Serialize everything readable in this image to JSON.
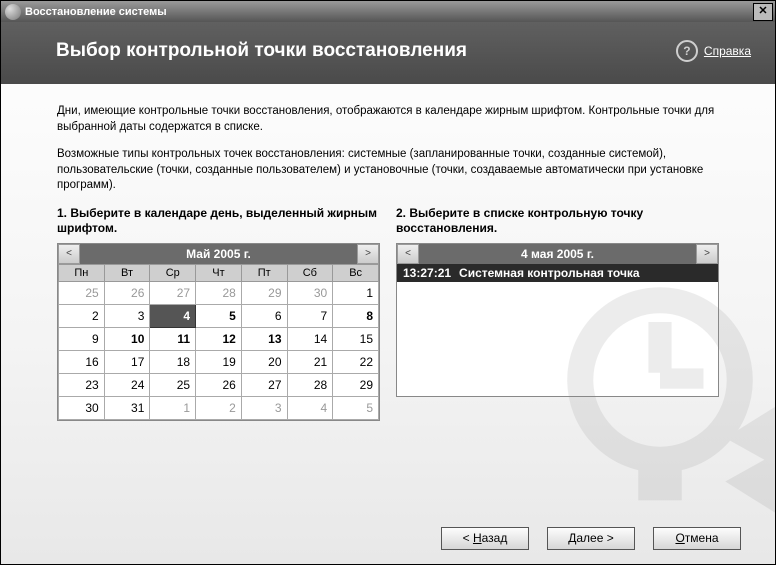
{
  "window": {
    "title": "Восстановление системы",
    "close_glyph": "✕"
  },
  "header": {
    "title": "Выбор контрольной точки восстановления",
    "help_link": "Справка",
    "help_glyph": "?"
  },
  "intro": {
    "p1": "Дни, имеющие контрольные точки восстановления, отображаются в календаре жирным шрифтом. Контрольные точки для выбранной даты содержатся в списке.",
    "p2": "Возможные типы контрольных точек восстановления: системные (запланированные точки, созданные системой), пользовательские (точки, созданные пользователем) и установочные (точки, создаваемые автоматически при установке программ)."
  },
  "steps": {
    "step1_label": "1. Выберите в календаре день, выделенный жирным шрифтом.",
    "step2_label": "2. Выберите в списке контрольную точку восстановления."
  },
  "calendar": {
    "prev_glyph": "<",
    "next_glyph": ">",
    "month_label": "Май 2005 г.",
    "weekdays": [
      "Пн",
      "Вт",
      "Ср",
      "Чт",
      "Пт",
      "Сб",
      "Вс"
    ],
    "weeks": [
      [
        {
          "d": 25,
          "other": true
        },
        {
          "d": 26,
          "other": true
        },
        {
          "d": 27,
          "other": true
        },
        {
          "d": 28,
          "other": true
        },
        {
          "d": 29,
          "other": true
        },
        {
          "d": 30,
          "other": true
        },
        {
          "d": 1
        }
      ],
      [
        {
          "d": 2
        },
        {
          "d": 3
        },
        {
          "d": 4,
          "bold": true,
          "selected": true
        },
        {
          "d": 5,
          "bold": true
        },
        {
          "d": 6
        },
        {
          "d": 7
        },
        {
          "d": 8,
          "bold": true
        }
      ],
      [
        {
          "d": 9
        },
        {
          "d": 10,
          "bold": true
        },
        {
          "d": 11,
          "bold": true
        },
        {
          "d": 12,
          "bold": true
        },
        {
          "d": 13,
          "bold": true
        },
        {
          "d": 14
        },
        {
          "d": 15
        }
      ],
      [
        {
          "d": 16
        },
        {
          "d": 17
        },
        {
          "d": 18
        },
        {
          "d": 19
        },
        {
          "d": 20
        },
        {
          "d": 21
        },
        {
          "d": 22
        }
      ],
      [
        {
          "d": 23
        },
        {
          "d": 24
        },
        {
          "d": 25
        },
        {
          "d": 26
        },
        {
          "d": 27
        },
        {
          "d": 28
        },
        {
          "d": 29
        }
      ],
      [
        {
          "d": 30
        },
        {
          "d": 31
        },
        {
          "d": 1,
          "other": true
        },
        {
          "d": 2,
          "other": true
        },
        {
          "d": 3,
          "other": true
        },
        {
          "d": 4,
          "other": true
        },
        {
          "d": 5,
          "other": true
        }
      ]
    ]
  },
  "restore_points": {
    "date_label": "4 мая 2005 г.",
    "prev_glyph": "<",
    "next_glyph": ">",
    "items": [
      {
        "time": "13:27:21",
        "desc": "Системная контрольная точка",
        "selected": true
      }
    ]
  },
  "buttons": {
    "back": "< Назад",
    "back_u": "Н",
    "next_prefix": "Далее ",
    "next_suffix": ">",
    "next_u": "Д",
    "cancel": "Отмена",
    "cancel_u": "О"
  }
}
